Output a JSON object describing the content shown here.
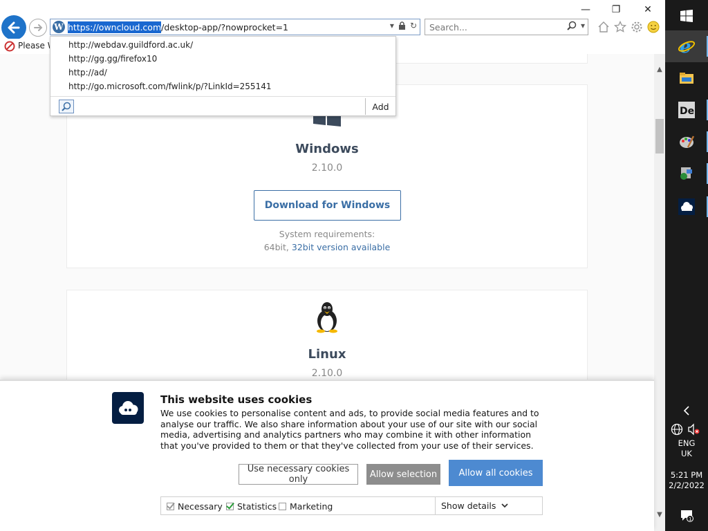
{
  "browser": {
    "url_selected": "https://owncloud.com",
    "url_rest": "/desktop-app/?nowprocket=1",
    "search_placeholder": "Search...",
    "notification_text": "Please W",
    "autocomplete": [
      "http://webdav.guildford.ac.uk/",
      "http://gg.gg/firefox10",
      "http://ad/",
      "http://go.microsoft.com/fwlink/p/?LinkId=255141"
    ],
    "autocomplete_add_label": "Add",
    "window_controls": {
      "minimize": "—",
      "restore": "❐",
      "close": "✕"
    }
  },
  "windows_card": {
    "title": "Windows",
    "version": "2.10.0",
    "download_label": "Download for Windows",
    "sysreq_label": "System requirements:",
    "sysreq_arch": "64bit,",
    "sysreq_link": "32bit version available"
  },
  "linux_card": {
    "title": "Linux",
    "version": "2.10.0"
  },
  "cookie": {
    "title": "This website uses cookies",
    "text": "We use cookies to personalise content and ads, to provide social media features and to analyse our traffic. We also share information about your use of our site with our social media, advertising and analytics partners who may combine it with other information that you've provided to them or that they've collected from your use of their services.",
    "btn_necessary": "Use necessary cookies only",
    "btn_selection": "Allow selection",
    "btn_all": "Allow all cookies",
    "opt_necessary": "Necessary",
    "opt_statistics": "Statistics",
    "opt_marketing": "Marketing",
    "show_details": "Show details"
  },
  "taskbar": {
    "language": "ENG",
    "region": "UK",
    "time": "5:21 PM",
    "date": "2/2/2022"
  },
  "colors": {
    "accent": "#3a6ea5",
    "cookie_btn_all": "#4d8ad1",
    "cookie_btn_selection": "#8d8d8d",
    "owncloud_navy": "#041e42",
    "taskbar_bg": "#1a1a1a"
  }
}
